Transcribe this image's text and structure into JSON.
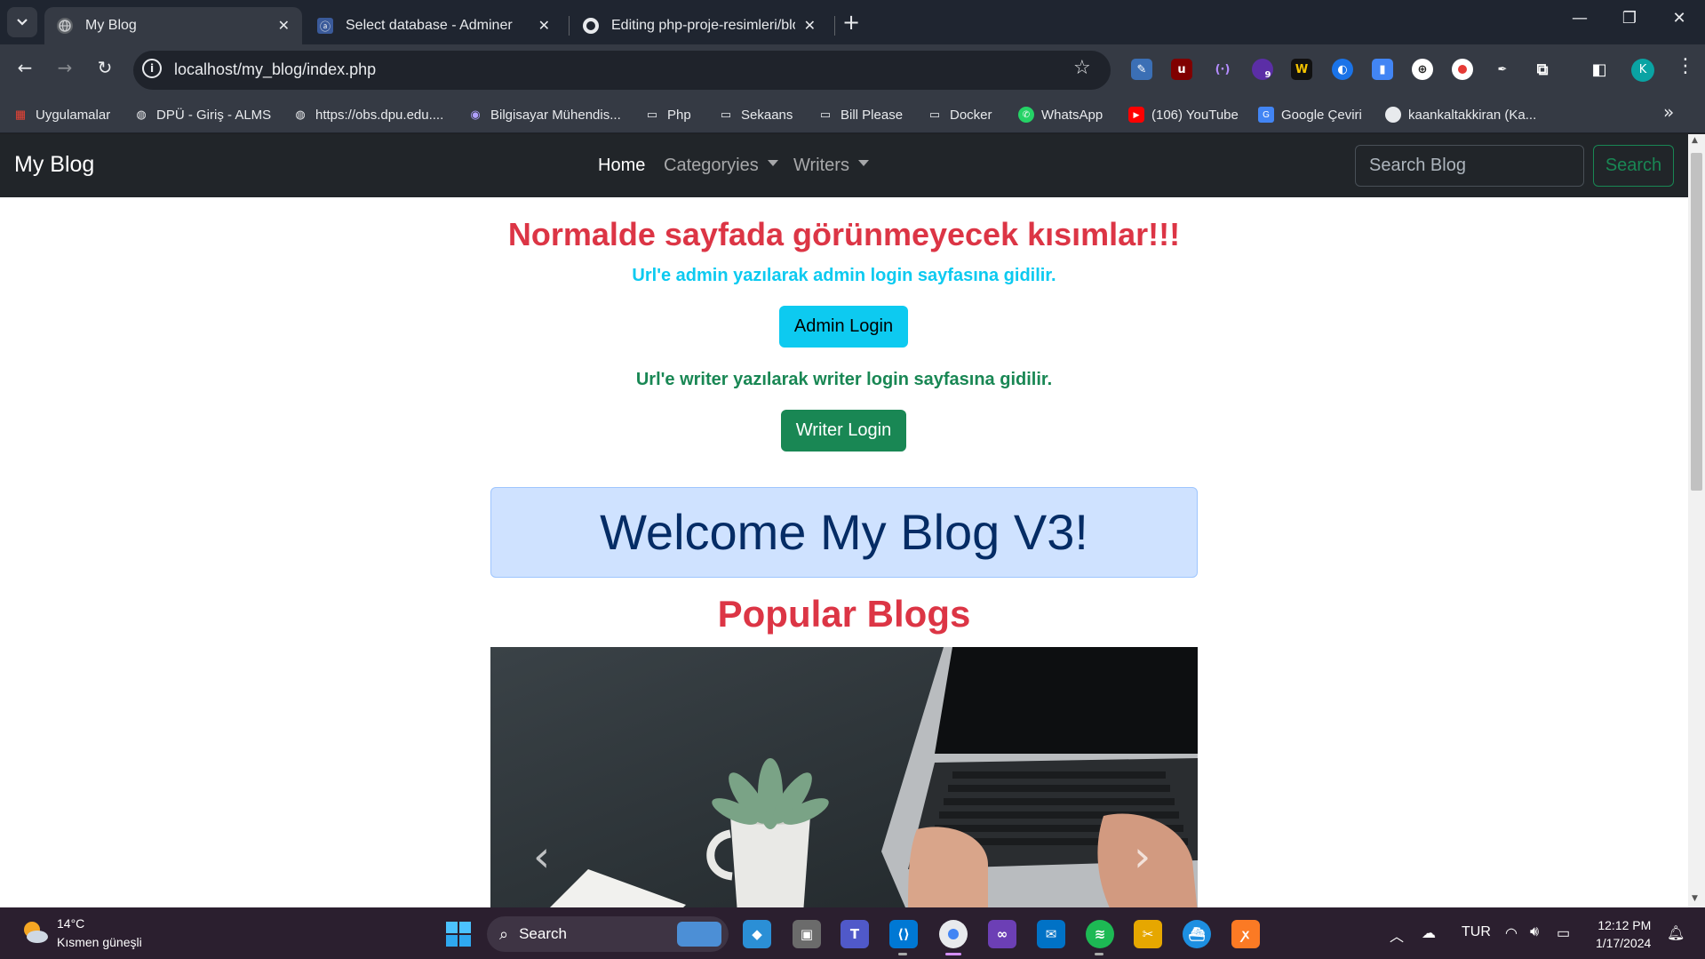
{
  "browser": {
    "tabs": [
      {
        "title": "My Blog",
        "active": true
      },
      {
        "title": "Select database - Adminer",
        "active": false
      },
      {
        "title": "Editing php-proje-resimleri/blo",
        "active": false
      }
    ],
    "url": "localhost/my_blog/index.php",
    "profile_initial": "K",
    "extension_badge": "9",
    "bookmarks": [
      "Uygulamalar",
      "DPÜ - Giriş - ALMS",
      "https://obs.dpu.edu....",
      "Bilgisayar Mühendis...",
      "Php",
      "Sekaans",
      "Bill Please",
      "Docker",
      "WhatsApp",
      "(106) YouTube",
      "Google Çeviri",
      "kaankaltakkiran (Ka..."
    ]
  },
  "navbar": {
    "brand": "My Blog",
    "links": {
      "home": "Home",
      "categories": "Categoryies",
      "writers": "Writers"
    },
    "search_placeholder": "Search Blog",
    "search_button": "Search"
  },
  "main": {
    "notice_title": "Normalde sayfada görünmeyecek kısımlar!!!",
    "admin_hint": "Url'e admin yazılarak admin login sayfasına gidilir.",
    "admin_button": "Admin Login",
    "writer_hint": "Url'e writer yazılarak writer login sayfasına gidilir.",
    "writer_button": "Writer Login",
    "welcome": "Welcome My Blog V3!",
    "popular_heading": "Popular Blogs"
  },
  "colors": {
    "danger": "#dc3545",
    "info": "#0dcaf0",
    "success": "#198754",
    "alert_primary_bg": "#cfe2ff",
    "navbar_bg": "#212529"
  },
  "taskbar": {
    "weather_temp": "14°C",
    "weather_desc": "Kısmen güneşli",
    "search_label": "Search",
    "language": "TUR",
    "time": "12:12 PM",
    "date": "1/17/2024"
  }
}
